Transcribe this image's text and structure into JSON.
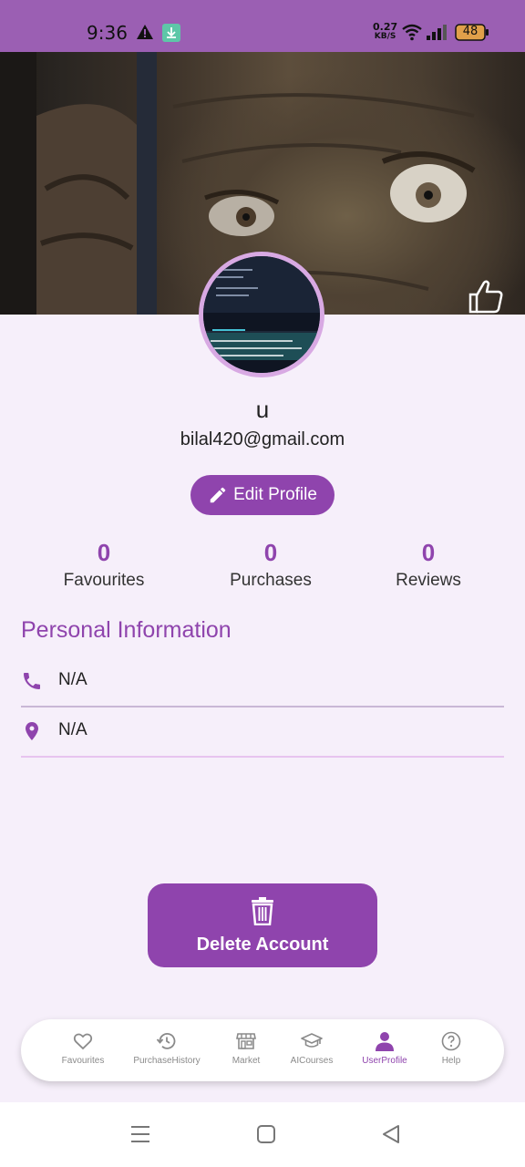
{
  "status_bar": {
    "time": "9:36",
    "net_speed_value": "0.27",
    "net_speed_unit": "KB/S",
    "battery": "48",
    "icons": [
      "warning-icon",
      "download-icon",
      "wifi-icon",
      "signal-icon",
      "battery-icon"
    ],
    "color": "#9b5fb3"
  },
  "profile": {
    "username": "u",
    "email": "bilal420@gmail.com",
    "edit_label": "Edit Profile"
  },
  "stats": [
    {
      "value": "0",
      "label": "Favourites"
    },
    {
      "value": "0",
      "label": "Purchases"
    },
    {
      "value": "0",
      "label": "Reviews"
    }
  ],
  "personal_info": {
    "title": "Personal Information",
    "phone": "N/A",
    "location": "N/A"
  },
  "delete_label": "Delete Account",
  "bottom_nav": [
    {
      "label": "Favourites",
      "icon": "heart-icon"
    },
    {
      "label": "PurchaseHistory",
      "icon": "history-icon"
    },
    {
      "label": "Market",
      "icon": "store-icon"
    },
    {
      "label": "AICourses",
      "icon": "graduation-cap-icon"
    },
    {
      "label": "UserProfile",
      "icon": "person-icon",
      "active": true
    },
    {
      "label": "Help",
      "icon": "help-icon"
    }
  ],
  "colors": {
    "accent": "#8f44ad",
    "background": "#f6effa",
    "avatar_border": "#d8a9e3"
  }
}
